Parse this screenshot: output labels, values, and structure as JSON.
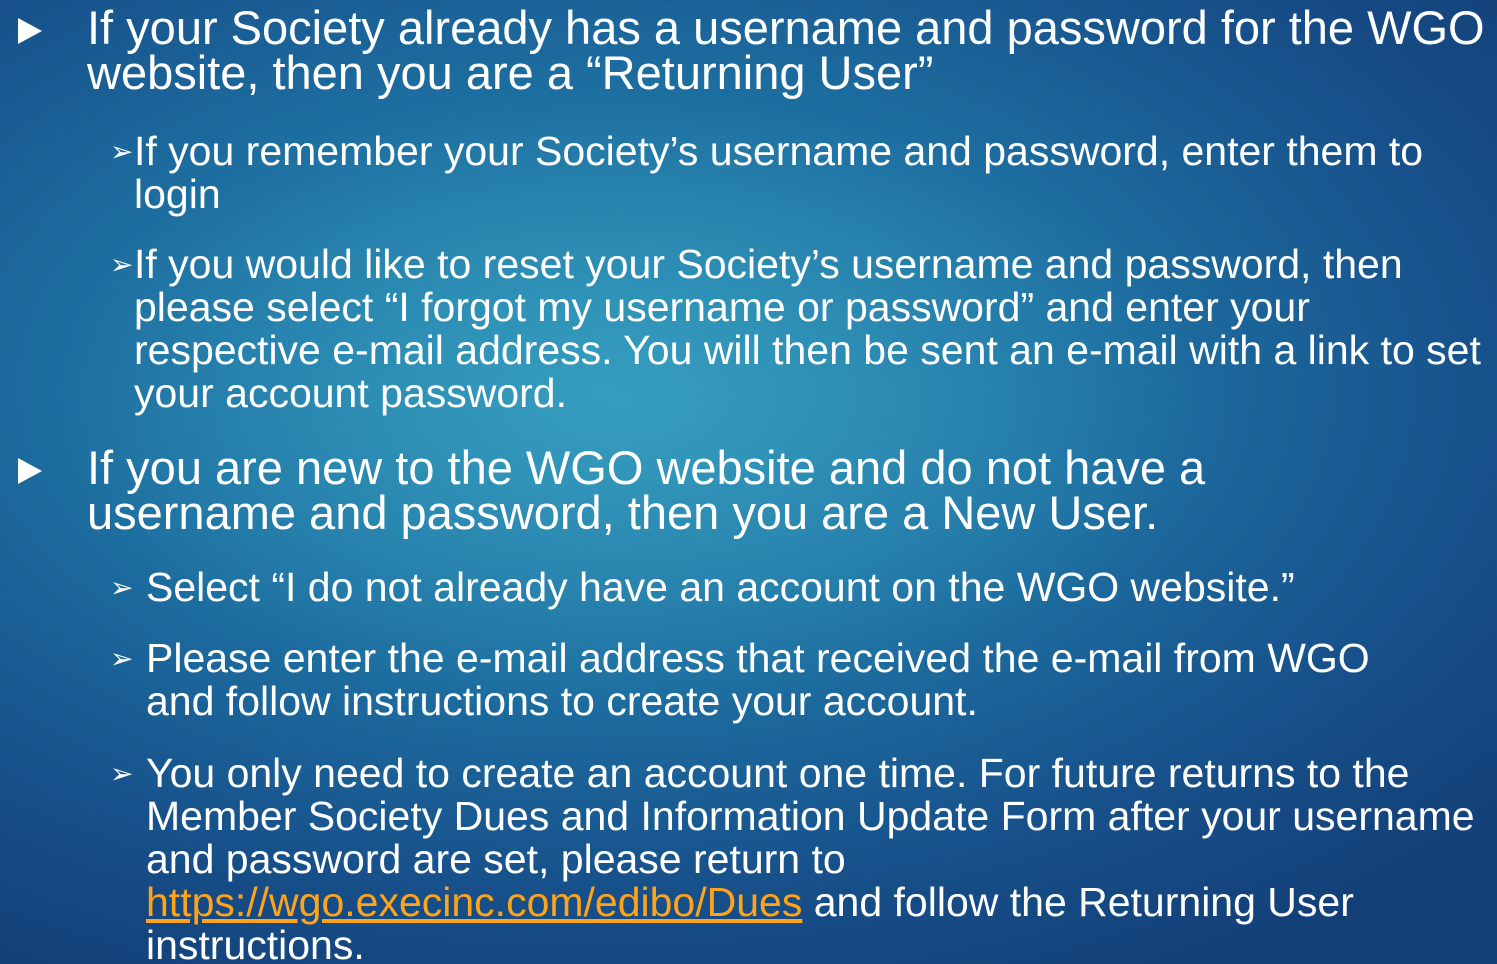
{
  "bullets": {
    "returning": {
      "text": "If your Society already has a username and password for the WGO website, then you are a “Returning User”",
      "sub": [
        "If you remember your Society’s username and password, enter them to login",
        "If you would like to reset your Society’s username and password, then please select “I forgot my username or password” and enter your respective e-mail address. You will then be sent an e-mail with a link to set your account password."
      ]
    },
    "new_user": {
      "text": "If you are new to the WGO website and do not have a username and password, then you are a New User.",
      "sub": [
        "Select “I do not already have an account on the WGO website.”",
        "Please enter the e-mail address that received the e-mail from WGO and follow instructions to create your account."
      ],
      "last": {
        "before": "You only need to create an account one time. For future returns to the Member Society Dues and Information Update Form after your username and password are set, please return to ",
        "link": "https://wgo.execinc.com/edibo/Dues",
        "after": " and follow the Returning User instructions."
      }
    }
  },
  "icons": {
    "level1": "play-triangle-icon",
    "level2": "chevron-arrow-icon",
    "level2_glyph": "➢"
  },
  "colors": {
    "link": "#ffa31a",
    "text": "#ffffff"
  }
}
